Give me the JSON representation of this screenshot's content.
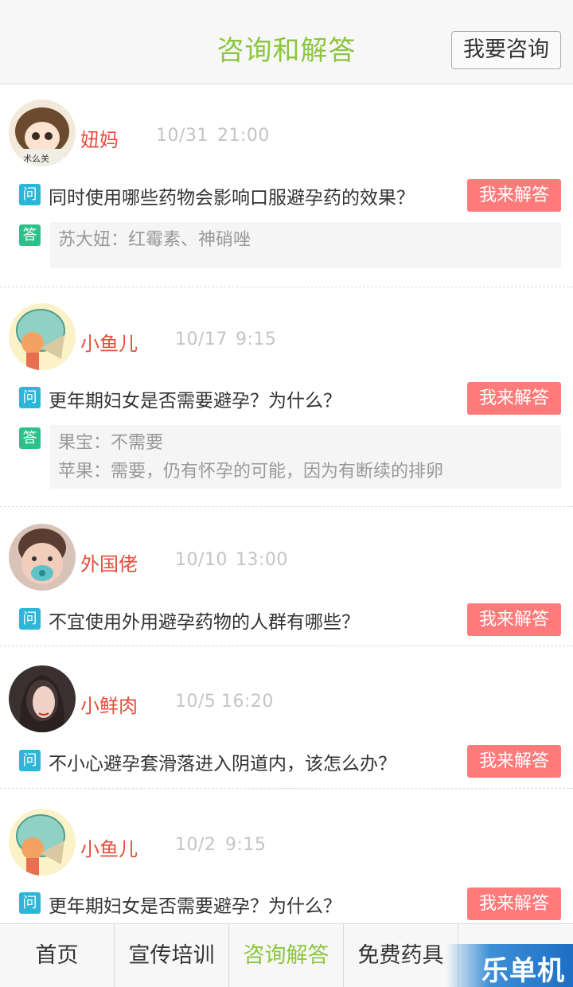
{
  "header": {
    "title": "咨询和解答",
    "ask_button": "我要咨询"
  },
  "labels": {
    "question_tag": "问",
    "answer_tag": "答",
    "answer_button": "我来解答"
  },
  "posts": [
    {
      "name": "妞妈",
      "date": "10/31",
      "time": "21:00",
      "question": "同时使用哪些药物会影响口服避孕药的效果？",
      "answers": [
        "苏大妞：红霉素、神硝唑"
      ]
    },
    {
      "name": "小鱼儿",
      "date": "10/17",
      "time": "9:15",
      "question": "更年期妇女是否需要避孕？为什么？",
      "answers": [
        "果宝：不需要",
        "苹果：需要，仍有怀孕的可能，因为有断续的排卵"
      ]
    },
    {
      "name": "外国佬",
      "date": "10/10",
      "time": "13:00",
      "question": "不宜使用外用避孕药物的人群有哪些？",
      "answers": []
    },
    {
      "name": "小鲜肉",
      "date": "10/5",
      "time": "16:20",
      "question": "不小心避孕套滑落进入阴道内，该怎么办？",
      "answers": []
    },
    {
      "name": "小鱼儿",
      "date": "10/2",
      "time": "9:15",
      "question": "更年期妇女是否需要避孕？为什么？",
      "answers": []
    }
  ],
  "nav": {
    "tabs": [
      "首页",
      "宣传培训",
      "咨询解答",
      "免费药具",
      ""
    ],
    "active_index": 2
  },
  "watermark": "乐单机",
  "colors": {
    "accent": "#8cc63f",
    "name": "#e74c3c",
    "answer_button": "#ff7b7b",
    "question_tag": "#2ab7d8",
    "answer_tag": "#2bc28a"
  }
}
